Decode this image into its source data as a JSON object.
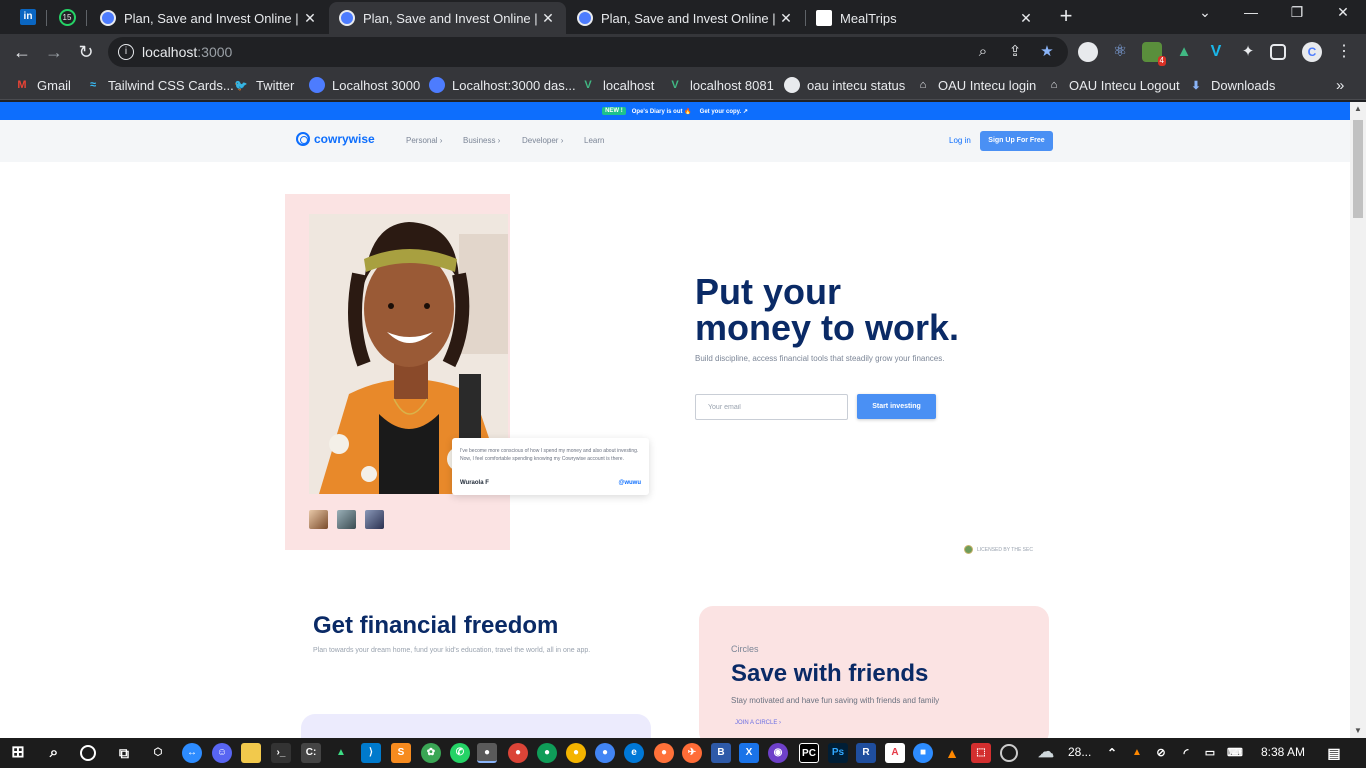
{
  "browser": {
    "pinned_tabs": [
      {
        "icon": "linkedin-icon",
        "label": "in"
      },
      {
        "icon": "whatsapp-icon",
        "badge": "15"
      }
    ],
    "tabs": [
      {
        "title": "Plan, Save and Invest Online | Get",
        "active": false
      },
      {
        "title": "Plan, Save and Invest Online | Get",
        "active": true
      },
      {
        "title": "Plan, Save and Invest Online | Get",
        "active": false
      },
      {
        "title": "MealTrips",
        "active": false
      }
    ],
    "close_glyph": "✕",
    "new_tab_glyph": "+",
    "url_host": "localhost",
    "url_port": ":3000",
    "extension_badge": "4",
    "bookmarks": [
      {
        "label": "Gmail",
        "icon": "gmail-icon",
        "color": "#ea4335"
      },
      {
        "label": "Tailwind CSS Cards...",
        "icon": "tailwind-icon",
        "color": "#38bdf8"
      },
      {
        "label": "Twitter",
        "icon": "twitter-icon",
        "color": "#1d9bf0"
      },
      {
        "label": "Localhost 3000",
        "icon": "cowrywise-icon",
        "color": "#4d7cfe"
      },
      {
        "label": "Localhost:3000 das...",
        "icon": "cowrywise-icon",
        "color": "#4d7cfe"
      },
      {
        "label": "localhost",
        "icon": "vue-icon",
        "color": "#41b883"
      },
      {
        "label": "localhost 8081",
        "icon": "vue-icon",
        "color": "#41b883"
      },
      {
        "label": "oau intecu status",
        "icon": "github-icon",
        "color": "#e8eaed"
      },
      {
        "label": "OAU Intecu login",
        "icon": "home-icon",
        "color": "#e8eaed"
      },
      {
        "label": "OAU Intecu Logout",
        "icon": "home-icon",
        "color": "#e8eaed"
      },
      {
        "label": "Downloads",
        "icon": "download-icon",
        "color": "#8ab4f8"
      }
    ],
    "more_bookmarks": "»"
  },
  "page": {
    "promo": {
      "badge": "NEW !",
      "text": "Ope's Diary is out 🔥",
      "cta": "Get your copy. ↗"
    },
    "nav": {
      "logo": "cowrywise",
      "links": [
        "Personal ›",
        "Business ›",
        "Developer ›",
        "Learn"
      ],
      "login": "Log in",
      "signup": "Sign Up For Free"
    },
    "hero": {
      "title_line1": "Put your",
      "title_line2": "money to work.",
      "subtitle": "Build discipline, access financial tools that steadily grow your finances.",
      "email_placeholder": "Your email",
      "email_value": "",
      "cta": "Start investing",
      "testimonial": {
        "quote": "I've become more conscious of how I spend my money and also about investing. Now, I feel comfortable spending knowing my Cowrywise account is there.",
        "name": "Wuraola F",
        "handle": "@wuwu"
      },
      "licensed": "LICENSED BY THE SEC"
    },
    "freedom": {
      "title": "Get financial freedom",
      "subtitle": "Plan towards your dream home, fund your kid's education, travel the world, all in one app."
    },
    "circles": {
      "eyebrow": "Circles",
      "title": "Save with friends",
      "subtitle": "Stay motivated and have fun saving with friends and family",
      "link": "JOIN A CIRCLE ›"
    }
  },
  "taskbar": {
    "weather": "28...",
    "time": "8:38 AM"
  }
}
